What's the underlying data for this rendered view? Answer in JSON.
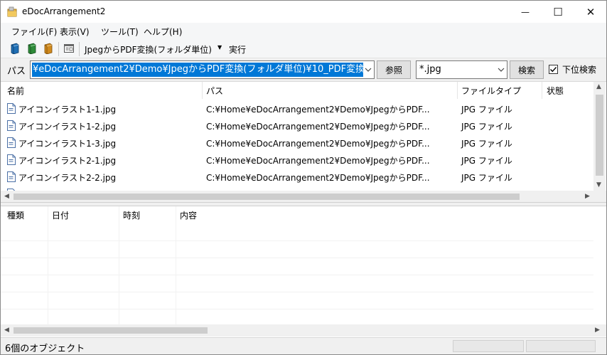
{
  "window": {
    "title": "eDocArrangement2"
  },
  "window_controls": {
    "minimize": "—",
    "maximize": "☐",
    "close": "✕"
  },
  "menu": [
    "ファイル(F)",
    "表示(V)",
    "ツール(T)",
    "ヘルプ(H)"
  ],
  "toolbar": {
    "mode": "JpegからPDF変換(フォルダ単位)",
    "run_label": "実行"
  },
  "pathbar": {
    "label": "パス",
    "value": "¥eDocArrangement2¥Demo¥JpegからPDF変換(フォルダ単位)¥10_PDF変換",
    "browse_label": "参照",
    "filter_value": "*.jpg",
    "search_label": "検索",
    "subfolder_label": "下位検索",
    "subfolder_checked": true
  },
  "filelist": {
    "columns": [
      "名前",
      "パス",
      "ファイルタイプ",
      "状態"
    ],
    "rows": [
      {
        "name": "アイコンイラスト1-1.jpg",
        "path": "C:¥Home¥eDocArrangement2¥Demo¥JpegからPDF...",
        "type": "JPG ファイル",
        "status": ""
      },
      {
        "name": "アイコンイラスト1-2.jpg",
        "path": "C:¥Home¥eDocArrangement2¥Demo¥JpegからPDF...",
        "type": "JPG ファイル",
        "status": ""
      },
      {
        "name": "アイコンイラスト1-3.jpg",
        "path": "C:¥Home¥eDocArrangement2¥Demo¥JpegからPDF...",
        "type": "JPG ファイル",
        "status": ""
      },
      {
        "name": "アイコンイラスト2-1.jpg",
        "path": "C:¥Home¥eDocArrangement2¥Demo¥JpegからPDF...",
        "type": "JPG ファイル",
        "status": ""
      },
      {
        "name": "アイコンイラスト2-2.jpg",
        "path": "C:¥Home¥eDocArrangement2¥Demo¥JpegからPDF...",
        "type": "JPG ファイル",
        "status": ""
      }
    ]
  },
  "log": {
    "columns": [
      "種類",
      "日付",
      "時刻",
      "内容"
    ]
  },
  "status": {
    "text": "6個のオブジェクト"
  },
  "colors": {
    "selection": "#0078d7",
    "accent_check": "#000000"
  },
  "icons": [
    "app-folder-icon",
    "book-blue-icon",
    "book-green-icon",
    "book-orange-icon",
    "window-list-icon",
    "file-icon"
  ]
}
